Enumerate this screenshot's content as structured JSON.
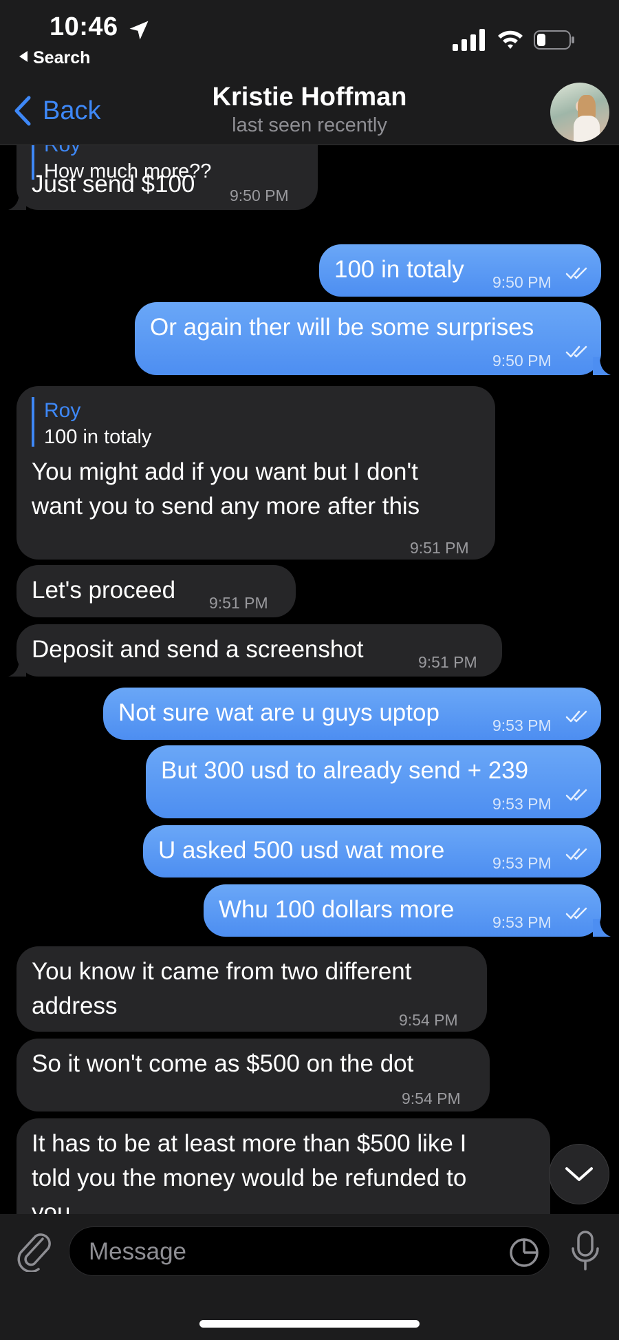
{
  "status_bar": {
    "time": "10:46",
    "back_app": "Search"
  },
  "header": {
    "back_label": "Back",
    "title": "Kristie Hoffman",
    "subtitle": "last seen recently"
  },
  "messages": [
    {
      "dir": "in",
      "reply_name": "Roy",
      "reply_text": "How much more??",
      "lines": [
        "Just send $100"
      ],
      "time": "9:50 PM"
    },
    {
      "dir": "out",
      "lines": [
        "100 in totaly"
      ],
      "time": "9:50 PM"
    },
    {
      "dir": "out",
      "lines": [
        "Or again ther will be some surprises"
      ],
      "time": "9:50 PM"
    },
    {
      "dir": "in",
      "reply_name": "Roy",
      "reply_text": "100 in totaly",
      "lines": [
        "You might add if you want but I don't",
        "want you to send any more after this"
      ],
      "time": "9:51 PM"
    },
    {
      "dir": "in",
      "lines": [
        "Let's proceed"
      ],
      "time": "9:51 PM"
    },
    {
      "dir": "in",
      "lines": [
        "Deposit and send a screenshot"
      ],
      "time": "9:51 PM"
    },
    {
      "dir": "out",
      "lines": [
        "Not sure wat are u guys uptop"
      ],
      "time": "9:53 PM"
    },
    {
      "dir": "out",
      "lines": [
        "But 300 usd to already send + 239"
      ],
      "time": "9:53 PM"
    },
    {
      "dir": "out",
      "lines": [
        "U asked 500 usd wat more"
      ],
      "time": "9:53 PM"
    },
    {
      "dir": "out",
      "lines": [
        "Whu 100 dollars more"
      ],
      "time": "9:53 PM"
    },
    {
      "dir": "in",
      "lines": [
        "You know it came from two different",
        "address"
      ],
      "time": "9:54 PM"
    },
    {
      "dir": "in",
      "lines": [
        "So it won't come as $500 on the dot"
      ],
      "time": "9:54 PM"
    },
    {
      "dir": "in",
      "lines": [
        "It has to be at least more than $500 like I",
        "told you the money would be refunded to",
        "you"
      ],
      "time": ""
    }
  ],
  "composer": {
    "placeholder": "Message"
  },
  "colors": {
    "accent": "#3e88f7",
    "outgoing": "#5d9ef5",
    "incoming": "#262628",
    "bar": "#1c1c1d"
  }
}
